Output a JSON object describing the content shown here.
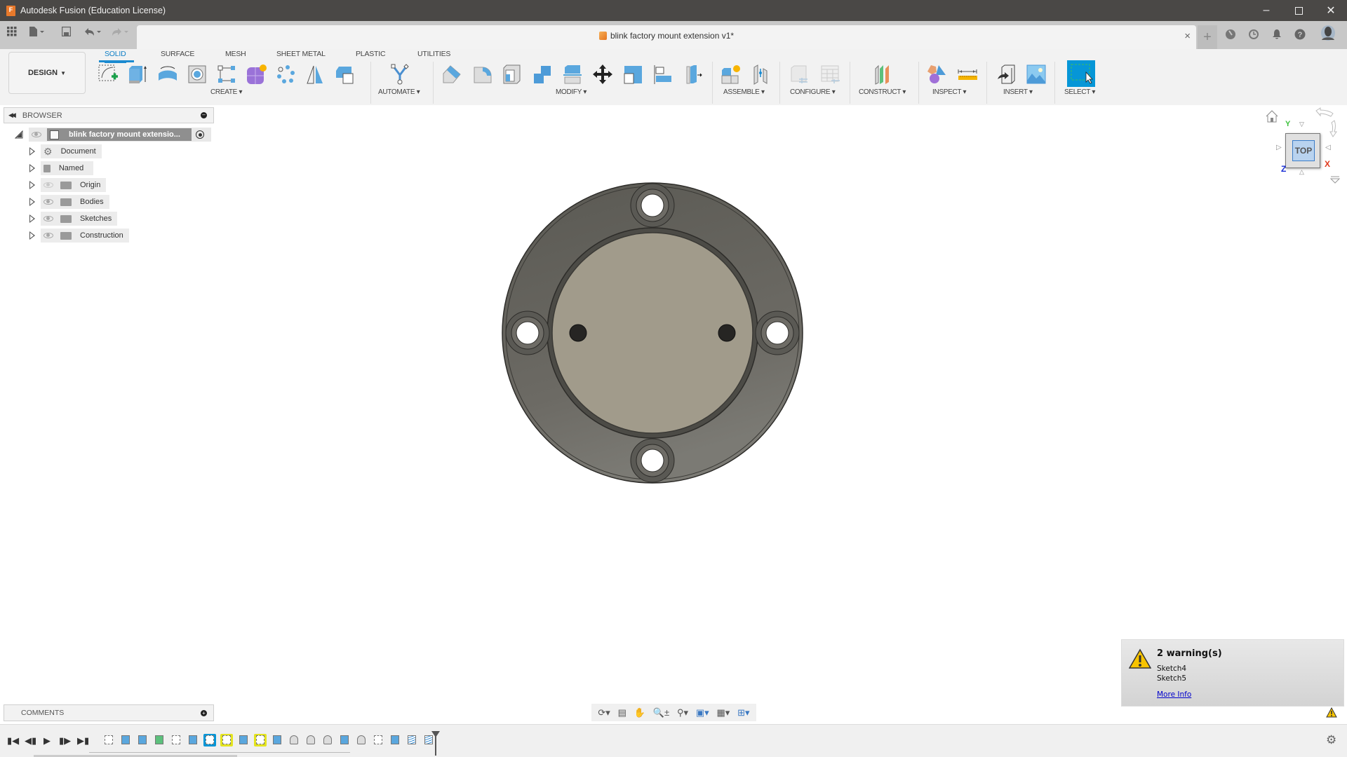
{
  "window": {
    "app_title": "Autodesk Fusion (Education License)",
    "minimize": "minimize",
    "maximize": "maximize",
    "close": "close"
  },
  "document_tab": {
    "name": "blink factory mount extension v1*",
    "close_glyph": "×"
  },
  "quick_access": {
    "icons": [
      "grid-icon",
      "file-icon",
      "save-icon",
      "undo-icon",
      "redo-icon"
    ]
  },
  "header_right_icons": [
    "new-tab-icon",
    "job-status-icon",
    "history-icon",
    "notifications-icon",
    "help-icon",
    "avatar"
  ],
  "workspace": {
    "label": "DESIGN",
    "tabs": [
      {
        "label": "SOLID",
        "active": true
      },
      {
        "label": "SURFACE",
        "active": false
      },
      {
        "label": "MESH",
        "active": false
      },
      {
        "label": "SHEET METAL",
        "active": false
      },
      {
        "label": "PLASTIC",
        "active": false
      },
      {
        "label": "UTILITIES",
        "active": false
      }
    ]
  },
  "toolbar_groups": [
    {
      "label": "CREATE",
      "tools": [
        "create-sketch",
        "extrude",
        "revolve",
        "hole",
        "rectangular-pattern-sketch",
        "form",
        "pattern",
        "mirror",
        "combine"
      ]
    },
    {
      "label": "AUTOMATE",
      "tools": [
        "automate"
      ]
    },
    {
      "label": "MODIFY",
      "tools": [
        "press-pull",
        "fillet",
        "shell",
        "combine",
        "split-face",
        "move",
        "scale",
        "align",
        "replace-face"
      ]
    },
    {
      "label": "ASSEMBLE",
      "tools": [
        "new-component",
        "joint"
      ]
    },
    {
      "label": "CONFIGURE",
      "tools": [
        "configure",
        "configuration-table"
      ]
    },
    {
      "label": "CONSTRUCT",
      "tools": [
        "offset-plane"
      ]
    },
    {
      "label": "INSPECT",
      "tools": [
        "interference",
        "measure"
      ]
    },
    {
      "label": "INSERT",
      "tools": [
        "insert-derive",
        "canvas"
      ]
    },
    {
      "label": "SELECT",
      "tools": [
        "select"
      ]
    }
  ],
  "browser": {
    "title": "BROWSER",
    "root": "blink factory mount extensio...",
    "items": [
      {
        "label": "Document Settings",
        "icon": "gear-icon",
        "visible": null
      },
      {
        "label": "Named Views",
        "icon": "folder-icon",
        "visible": null
      },
      {
        "label": "Origin",
        "icon": "folder-icon",
        "visible": false
      },
      {
        "label": "Bodies",
        "icon": "folder-icon",
        "visible": true
      },
      {
        "label": "Sketches",
        "icon": "folder-icon",
        "visible": true
      },
      {
        "label": "Construction",
        "icon": "folder-icon",
        "visible": true
      }
    ]
  },
  "viewcube": {
    "face": "TOP",
    "axes": {
      "y": "Y",
      "x": "X",
      "z": "Z"
    },
    "colors": {
      "y": "#3ec23e",
      "x": "#e03a1e",
      "z": "#1a2fd6"
    }
  },
  "comments": {
    "title": "COMMENTS"
  },
  "nav_bar": {
    "tools": [
      "orbit",
      "look-at",
      "pan",
      "zoom",
      "fit",
      "display-settings",
      "grid-snaps",
      "viewports"
    ]
  },
  "warnings": {
    "title": "2 warning(s)",
    "items": [
      "Sketch4",
      "Sketch5"
    ],
    "link": "More Info"
  },
  "timeline": {
    "controls": [
      "first",
      "previous",
      "play",
      "next",
      "last"
    ],
    "features": [
      {
        "type": "sketch",
        "state": "normal"
      },
      {
        "type": "extrude",
        "state": "normal"
      },
      {
        "type": "extrude",
        "state": "normal"
      },
      {
        "type": "plane",
        "state": "normal"
      },
      {
        "type": "sketch",
        "state": "normal"
      },
      {
        "type": "hole",
        "state": "normal"
      },
      {
        "type": "sketch",
        "state": "selected"
      },
      {
        "type": "sketch",
        "state": "warning"
      },
      {
        "type": "extrude",
        "state": "normal"
      },
      {
        "type": "sketch",
        "state": "warning"
      },
      {
        "type": "extrude",
        "state": "normal"
      },
      {
        "type": "chamfer",
        "state": "normal"
      },
      {
        "type": "fillet",
        "state": "normal"
      },
      {
        "type": "fillet",
        "state": "normal"
      },
      {
        "type": "extrude",
        "state": "normal"
      },
      {
        "type": "fillet",
        "state": "normal"
      },
      {
        "type": "sketch",
        "state": "normal"
      },
      {
        "type": "extrude",
        "state": "normal"
      },
      {
        "type": "thread",
        "state": "normal"
      },
      {
        "type": "thread",
        "state": "normal"
      }
    ]
  },
  "colors": {
    "accent": "#1b8ad0",
    "titlebar": "#4a4846",
    "warning_highlight": "#e4e41f",
    "selected_feature": "#0696d7",
    "body_outer": "#5d5b56",
    "body_inner": "#a09a8a"
  }
}
